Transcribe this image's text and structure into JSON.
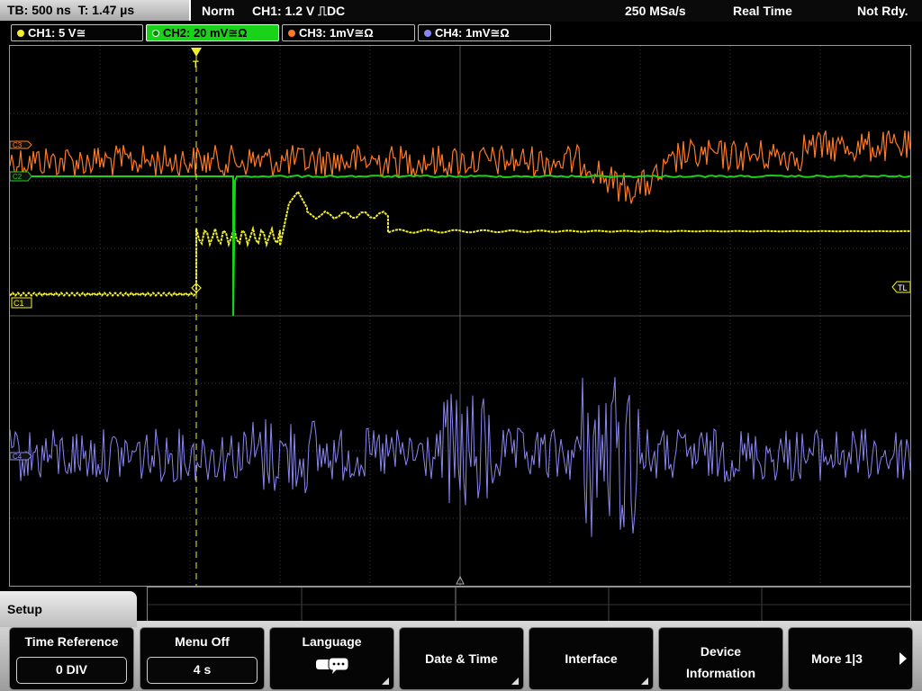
{
  "status": {
    "timebase": "TB: 500 ns",
    "trigger_time": "T: 1.47 µs",
    "mode": "Norm",
    "trigger_info": "CH1: 1.2 V ⎍DC",
    "sample_rate": "250 MSa/s",
    "acq_mode": "Real Time",
    "trigger_status": "Not Rdy."
  },
  "channels": [
    {
      "label": "CH1: 5 V≅",
      "color": "#f2ef2a"
    },
    {
      "label": "CH2: 20 mV≅Ω",
      "color": "#1bd21b"
    },
    {
      "label": "CH3: 1mV≅Ω",
      "color": "#ff7a26"
    },
    {
      "label": "CH4: 1mV≅Ω",
      "color": "#8a86f2"
    }
  ],
  "markers": {
    "ch1": "C1",
    "ch2": "C2",
    "ch3": "C3",
    "ch4": "C4",
    "trigger_level": "TL",
    "trigger_pos": "T"
  },
  "menu": {
    "title": "Setup",
    "softkeys": [
      {
        "label": "Time Reference",
        "value": "0 DIV"
      },
      {
        "label": "Menu Off",
        "value": "4 s"
      },
      {
        "label": "Language",
        "icon": "speech-bubble-icon"
      },
      {
        "label": "Date & Time"
      },
      {
        "label": "Interface"
      },
      {
        "label": "Device Information"
      },
      {
        "label": "More 1|3"
      }
    ]
  }
}
